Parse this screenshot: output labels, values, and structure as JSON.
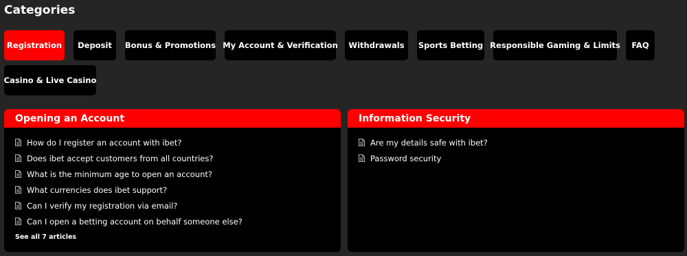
{
  "title": "Categories",
  "categories": [
    {
      "label": "Registration",
      "active": true
    },
    {
      "label": "Deposit",
      "active": false
    },
    {
      "label": "Bonus & Promotions",
      "active": false
    },
    {
      "label": "My Account & Verification",
      "active": false
    },
    {
      "label": "Withdrawals",
      "active": false
    },
    {
      "label": "Sports Betting",
      "active": false
    },
    {
      "label": "Responsible Gaming & Limits",
      "active": false
    },
    {
      "label": "FAQ",
      "active": false
    },
    {
      "label": "Casino & Live Casino",
      "active": false
    }
  ],
  "sections": [
    {
      "title": "Opening an Account",
      "articles": [
        "How do I register an account with ibet?",
        "Does ibet accept customers from all countries?",
        "What is the minimum age to open an account?",
        "What currencies does ibet support?",
        "Can I verify my registration via email?",
        "Can I open a betting account on behalf someone else?"
      ],
      "see_all": "See all 7 articles"
    },
    {
      "title": "Information Security",
      "articles": [
        "Are my details safe with ibet?",
        "Password security"
      ]
    }
  ],
  "icons": {
    "article": "document-icon"
  },
  "colors": {
    "accent": "#ff0000",
    "background": "#252525",
    "panel": "#000000",
    "text": "#ffffff"
  }
}
